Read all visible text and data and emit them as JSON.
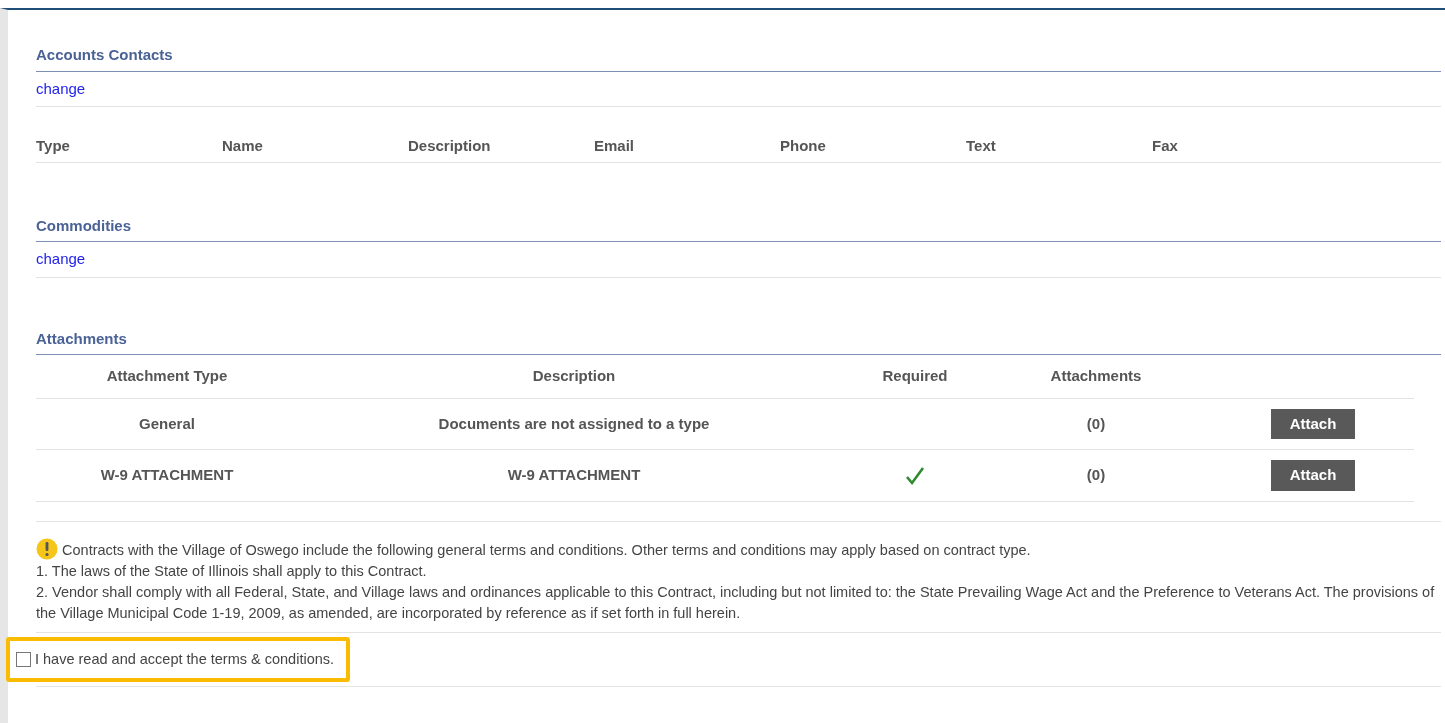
{
  "accounts_contacts": {
    "title": "Accounts Contacts",
    "change_link": "change",
    "columns": [
      "Type",
      "Name",
      "Description",
      "Email",
      "Phone",
      "Text",
      "Fax"
    ]
  },
  "commodities": {
    "title": "Commodities",
    "change_link": "change"
  },
  "attachments": {
    "title": "Attachments",
    "columns": [
      "Attachment Type",
      "Description",
      "Required",
      "Attachments"
    ],
    "rows": [
      {
        "type": "General",
        "description": "Documents are not assigned to a type",
        "required": false,
        "count": "(0)",
        "button": "Attach"
      },
      {
        "type": "W-9 ATTACHMENT",
        "description": "W-9 ATTACHMENT",
        "required": true,
        "count": "(0)",
        "button": "Attach"
      }
    ]
  },
  "terms": {
    "intro": "Contracts with the Village of Oswego include the following general terms and conditions. Other terms and conditions may apply based on contract type.",
    "items": [
      "1. The laws of the State of Illinois shall apply to this Contract.",
      "2. Vendor shall comply with all Federal, State, and Village laws and ordinances applicable to this Contract, including but not limited to: the State Prevailing Wage Act and the Preference to Veterans Act. The provisions of the Village Municipal Code 1-19, 2009, as amended, are incorporated by reference as if set forth in full herein."
    ],
    "accept_label": "I have read and accept the terms & conditions.",
    "accepted": false
  }
}
